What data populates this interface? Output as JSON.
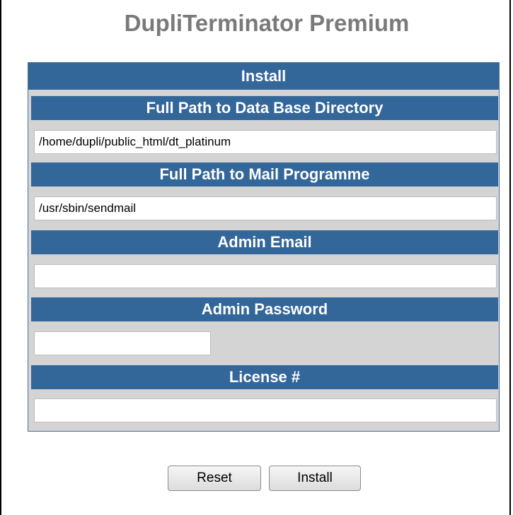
{
  "title": "DupliTerminator Premium",
  "install_section": {
    "header": "Install",
    "db_path": {
      "label": "Full Path to Data Base Directory",
      "value": "/home/dupli/public_html/dt_platinum"
    },
    "mail_path": {
      "label": "Full Path to Mail Programme",
      "value": "/usr/sbin/sendmail"
    },
    "admin_email": {
      "label": "Admin Email",
      "value": ""
    },
    "admin_password": {
      "label": "Admin Password",
      "value": ""
    },
    "license": {
      "label": "License #",
      "value": ""
    }
  },
  "buttons": {
    "reset": "Reset",
    "install": "Install"
  },
  "colors": {
    "header_bg": "#336699",
    "title": "#7a7a7a",
    "panel_bg": "#d4d4d4"
  }
}
